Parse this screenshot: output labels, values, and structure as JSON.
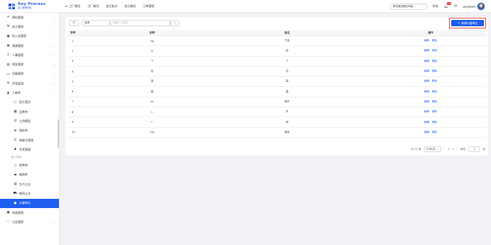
{
  "brand": {
    "title": "Any Process",
    "subtitle": "加工管理系统"
  },
  "topnav": [
    "工厂概览",
    "工厂概况",
    "加工批次",
    "加工概况",
    "订单管理"
  ],
  "tenant": {
    "value": "青岛新迈蛋白科技..."
  },
  "notifications": {
    "count": "10"
  },
  "help_label": "帮助",
  "user": {
    "name": "anyfamh"
  },
  "sidebar": {
    "items": [
      {
        "label": "原料管理",
        "icon": "layers-icon"
      },
      {
        "label": "加工管理",
        "icon": "tool-icon"
      },
      {
        "label": "投入品管理",
        "icon": "box-icon"
      },
      {
        "label": "溯源管理",
        "icon": "broadcast-icon"
      },
      {
        "label": "人事管理",
        "icon": "user-icon"
      },
      {
        "label": "财务管理",
        "icon": "document-icon"
      },
      {
        "label": "设备管理",
        "icon": "monitor-icon"
      },
      {
        "label": "环境监测",
        "icon": "gear-icon"
      },
      {
        "label": "三碳库",
        "icon": "book-icon"
      }
    ],
    "sub_items": [
      {
        "label": "加工类目",
        "icon": "cube-icon"
      },
      {
        "label": "品种库",
        "icon": "grid-icon"
      },
      {
        "label": "工序模型",
        "icon": "flow-icon"
      },
      {
        "label": "指标库",
        "icon": "list-icon"
      },
      {
        "label": "单据号管理",
        "icon": "clock-icon"
      },
      {
        "label": "专家管理",
        "icon": "users-icon"
      }
    ],
    "group_label": "投入品库",
    "group_items": [
      {
        "label": "稻种库",
        "icon": "circle-icon"
      },
      {
        "label": "器具库",
        "icon": "tray-icon"
      },
      {
        "label": "生产企业",
        "icon": "database-icon"
      },
      {
        "label": "售药企业",
        "icon": "cart-icon"
      },
      {
        "label": "计量单位",
        "icon": "drop-icon",
        "active": true
      }
    ],
    "bottom_items": [
      {
        "label": "系统管理",
        "icon": "window-icon"
      },
      {
        "label": "日志管理",
        "icon": "clock-circle-icon"
      }
    ]
  },
  "filter": {
    "field": "名称",
    "placeholder": "请输入关键词"
  },
  "add_button": {
    "label": "新增计量单位"
  },
  "table": {
    "headers": [
      "序号",
      "名称",
      "备注",
      "操作"
    ],
    "rows": [
      {
        "no": "1",
        "name": "kg",
        "remark": "千克"
      },
      {
        "no": "2",
        "name": "ā",
        "remark": "亩"
      },
      {
        "no": "3",
        "name": "个",
        "remark": "个"
      },
      {
        "no": "4",
        "name": "包",
        "remark": "包"
      },
      {
        "no": "5",
        "name": "袋",
        "remark": "袋"
      },
      {
        "no": "6",
        "name": "盒",
        "remark": "盒"
      },
      {
        "no": "7",
        "name": "ml",
        "remark": "毫升"
      },
      {
        "no": "8",
        "name": "L",
        "remark": "升"
      },
      {
        "no": "9",
        "name": "t",
        "remark": "吨"
      },
      {
        "no": "10",
        "name": "mg",
        "remark": "毫克"
      }
    ],
    "edit_label": "编辑",
    "delete_label": "删除"
  },
  "pagination": {
    "total": "共 12 条",
    "page_size": "10条/页",
    "pages": [
      "1",
      "2"
    ],
    "current": "1",
    "goto_label": "前往",
    "goto_value": "1",
    "page_suffix": "页"
  }
}
